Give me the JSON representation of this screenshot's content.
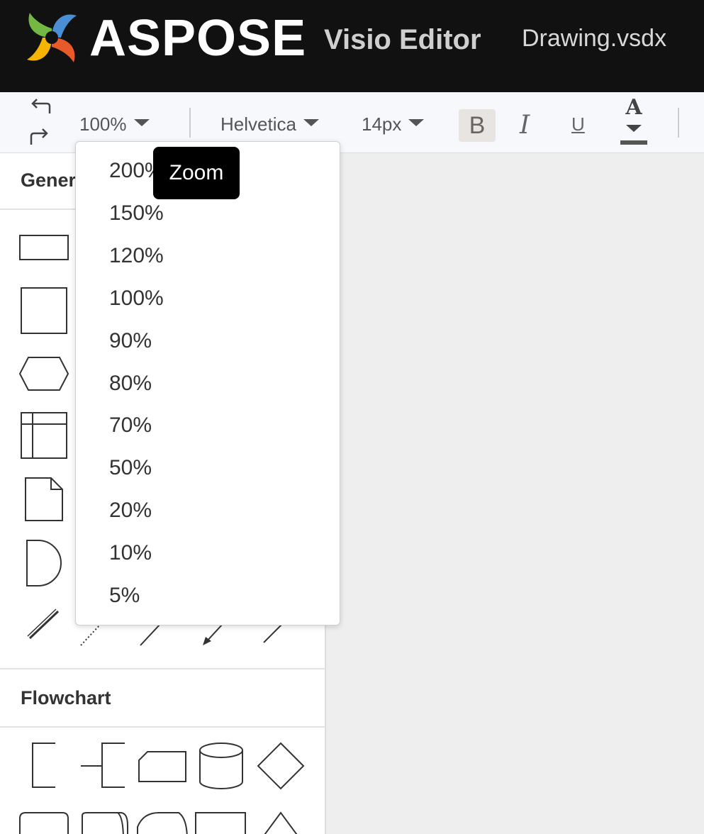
{
  "header": {
    "brand": "ASPOSE",
    "product": "Visio Editor",
    "filename": "Drawing.vsdx",
    "logo_icon": "aspose-swirl-logo-icon",
    "background": "#111111"
  },
  "toolbar": {
    "zoom_value": "100%",
    "font_family": "Helvetica",
    "font_size": "14px",
    "bold_label": "B",
    "italic_label": "I",
    "underline_label": "U",
    "font_color_label": "A",
    "icons": [
      "undo-icon",
      "redo-icon",
      "chevron-down-icon",
      "font-color-icon"
    ]
  },
  "zoom_menu": {
    "tooltip": "Zoom",
    "options": [
      "200%",
      "150%",
      "120%",
      "100%",
      "90%",
      "80%",
      "70%",
      "50%",
      "20%",
      "10%",
      "5%"
    ]
  },
  "sidebar": {
    "general_title": "Gener",
    "flowchart_title": "Flowchart"
  },
  "colors": {
    "canvas": "#eeeeee",
    "sidebar": "#ffffff",
    "tooltip": "#000000",
    "bold_active": "#e8e4e2"
  }
}
